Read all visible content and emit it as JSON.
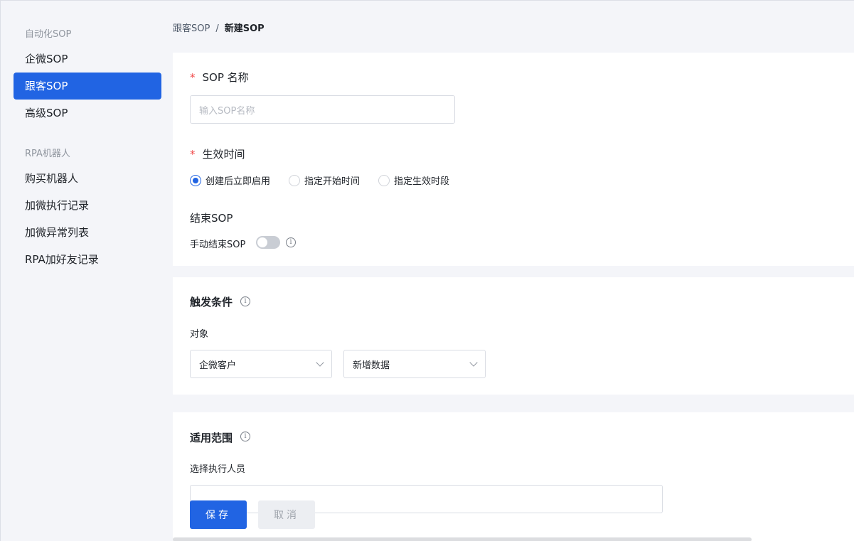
{
  "sidebar": {
    "group1": "自动化SOP",
    "group2": "RPA机器人",
    "items": [
      {
        "label": "企微SOP"
      },
      {
        "label": "跟客SOP"
      },
      {
        "label": "高级SOP"
      },
      {
        "label": "购买机器人"
      },
      {
        "label": "加微执行记录"
      },
      {
        "label": "加微异常列表"
      },
      {
        "label": "RPA加好友记录"
      }
    ]
  },
  "breadcrumb": {
    "parent": "跟客SOP",
    "separator": "/",
    "current": "新建SOP"
  },
  "form": {
    "required_mark": "*",
    "name_label": "SOP 名称",
    "name_placeholder": "输入SOP名称",
    "effective_label": "生效时间",
    "effective_options": [
      "创建后立即启用",
      "指定开始时间",
      "指定生效时段"
    ],
    "end_label": "结束SOP",
    "manual_end_label": "手动结束SOP",
    "manual_end_enabled": false
  },
  "trigger": {
    "title": "触发条件",
    "object_label": "对象",
    "object_select": "企微客户",
    "event_select": "新增数据"
  },
  "scope": {
    "title": "适用范围",
    "executor_label": "选择执行人员"
  },
  "actions": {
    "save": "保存",
    "cancel": "取消"
  },
  "icons": {
    "info": "info-circle-icon",
    "chevron": "chevron-down-icon"
  },
  "colors": {
    "accent": "#2164e3",
    "required": "#f04848"
  }
}
